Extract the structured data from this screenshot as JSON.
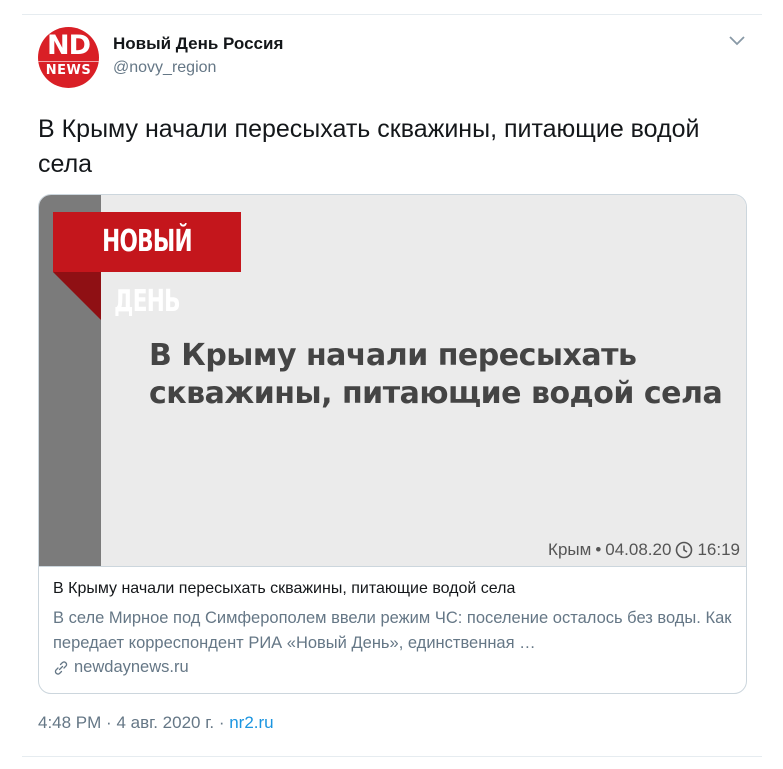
{
  "author": {
    "name": "Новый День Россия",
    "handle": "@novy_region",
    "avatar_top": "ND",
    "avatar_bottom": "NEWS"
  },
  "tweet": {
    "text": "В Крыму начали пересыхать скважины, питающие водой села"
  },
  "card": {
    "image": {
      "logo": "НОВЫЙ ДЕНЬ",
      "headline": "В Крыму начали пересыхать скважины, питающие водой села",
      "meta_region": "Крым",
      "meta_date": "04.08.20",
      "meta_time": "16:19"
    },
    "title": "В Крыму начали пересыхать скважины, питающие водой села",
    "description": "В селе Мирное под Симферополем ввели режим ЧС: поселение осталось без воды. Как передает корреспондент РИА «Новый День», единственная …",
    "domain": "newdaynews.ru"
  },
  "footer": {
    "time": "4:48 PM",
    "date": "4 авг. 2020 г.",
    "source": "nr2.ru"
  },
  "colors": {
    "brand_red": "#c4161c",
    "link_blue": "#1b95e0",
    "secondary_text": "#657786"
  }
}
